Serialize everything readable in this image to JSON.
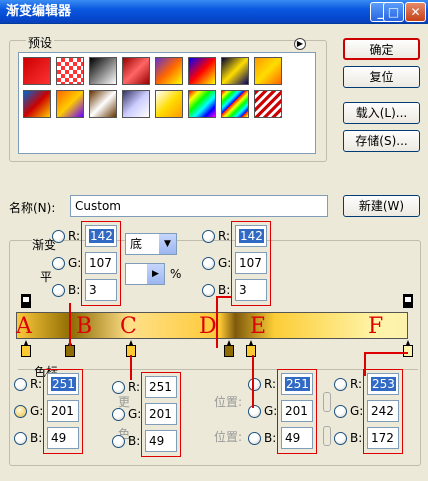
{
  "title": "渐变编辑器",
  "window_buttons": {
    "minimize": "_",
    "maximize": "□",
    "close": "✕"
  },
  "presets": {
    "label": "预设",
    "row1": [
      "linear-gradient(135deg,#c00,#f33)",
      "repeating-conic-gradient(#f33 0 25%,#fff 0 50%) 0 0/8px 8px",
      "linear-gradient(135deg,#000,#fff)",
      "linear-gradient(135deg,#900,#f66,#900)",
      "linear-gradient(135deg,#63c,#f60,#ff0)",
      "linear-gradient(135deg,#00f,#f00,#ff0)",
      "linear-gradient(135deg,#003,#fd0,#006)",
      "linear-gradient(135deg,#f90,#fd0,#f60)"
    ],
    "row2": [
      "linear-gradient(135deg,#06c,#c00,#fc0)",
      "linear-gradient(135deg,#f60,#fc0,#60f)",
      "linear-gradient(135deg,#630,#fff,#630)",
      "linear-gradient(135deg,#336,#ccf,#fff)",
      "linear-gradient(135deg,#fff,#fd0,#f90)",
      "linear-gradient(135deg,#f00,#ff0,#0f0,#0ff,#00f,#f0f)",
      "repeating-linear-gradient(135deg,#f00,#ff0 4px,#0f0 8px,#0ff 12px,#00f 16px)",
      "repeating-linear-gradient(135deg,#c00 0 3px,#fff 3px 6px)"
    ]
  },
  "buttons": {
    "ok": "确定",
    "reset": "复位",
    "load": "载入(L)...",
    "save": "存储(S)...",
    "new": "新建(W)"
  },
  "name_label": "名称(N):",
  "name_value": "Custom",
  "section": {
    "type_label": "渐变",
    "smooth_label": "平",
    "select_text": "底",
    "percent": "%",
    "stops_label": "色标"
  },
  "rgb_letters": {
    "r": "R:",
    "g": "G:",
    "b": "B:"
  },
  "top_colors": [
    {
      "r": "142",
      "g": "107",
      "b": "3"
    },
    {
      "r": "142",
      "g": "107",
      "b": "3"
    }
  ],
  "bottom_colors": [
    {
      "r": "251",
      "g": "201",
      "b": "49"
    },
    {
      "r": "251",
      "g": "201",
      "b": "49"
    },
    {
      "r": "251",
      "g": "201",
      "b": "49"
    },
    {
      "r": "253",
      "g": "242",
      "b": "172"
    }
  ],
  "partial_labels": {
    "pos1": "位置:",
    "pos2": "位置:",
    "frag1": "更",
    "frag2": "色"
  },
  "letters": [
    "A",
    "B",
    "C",
    "D",
    "E",
    "F"
  ]
}
